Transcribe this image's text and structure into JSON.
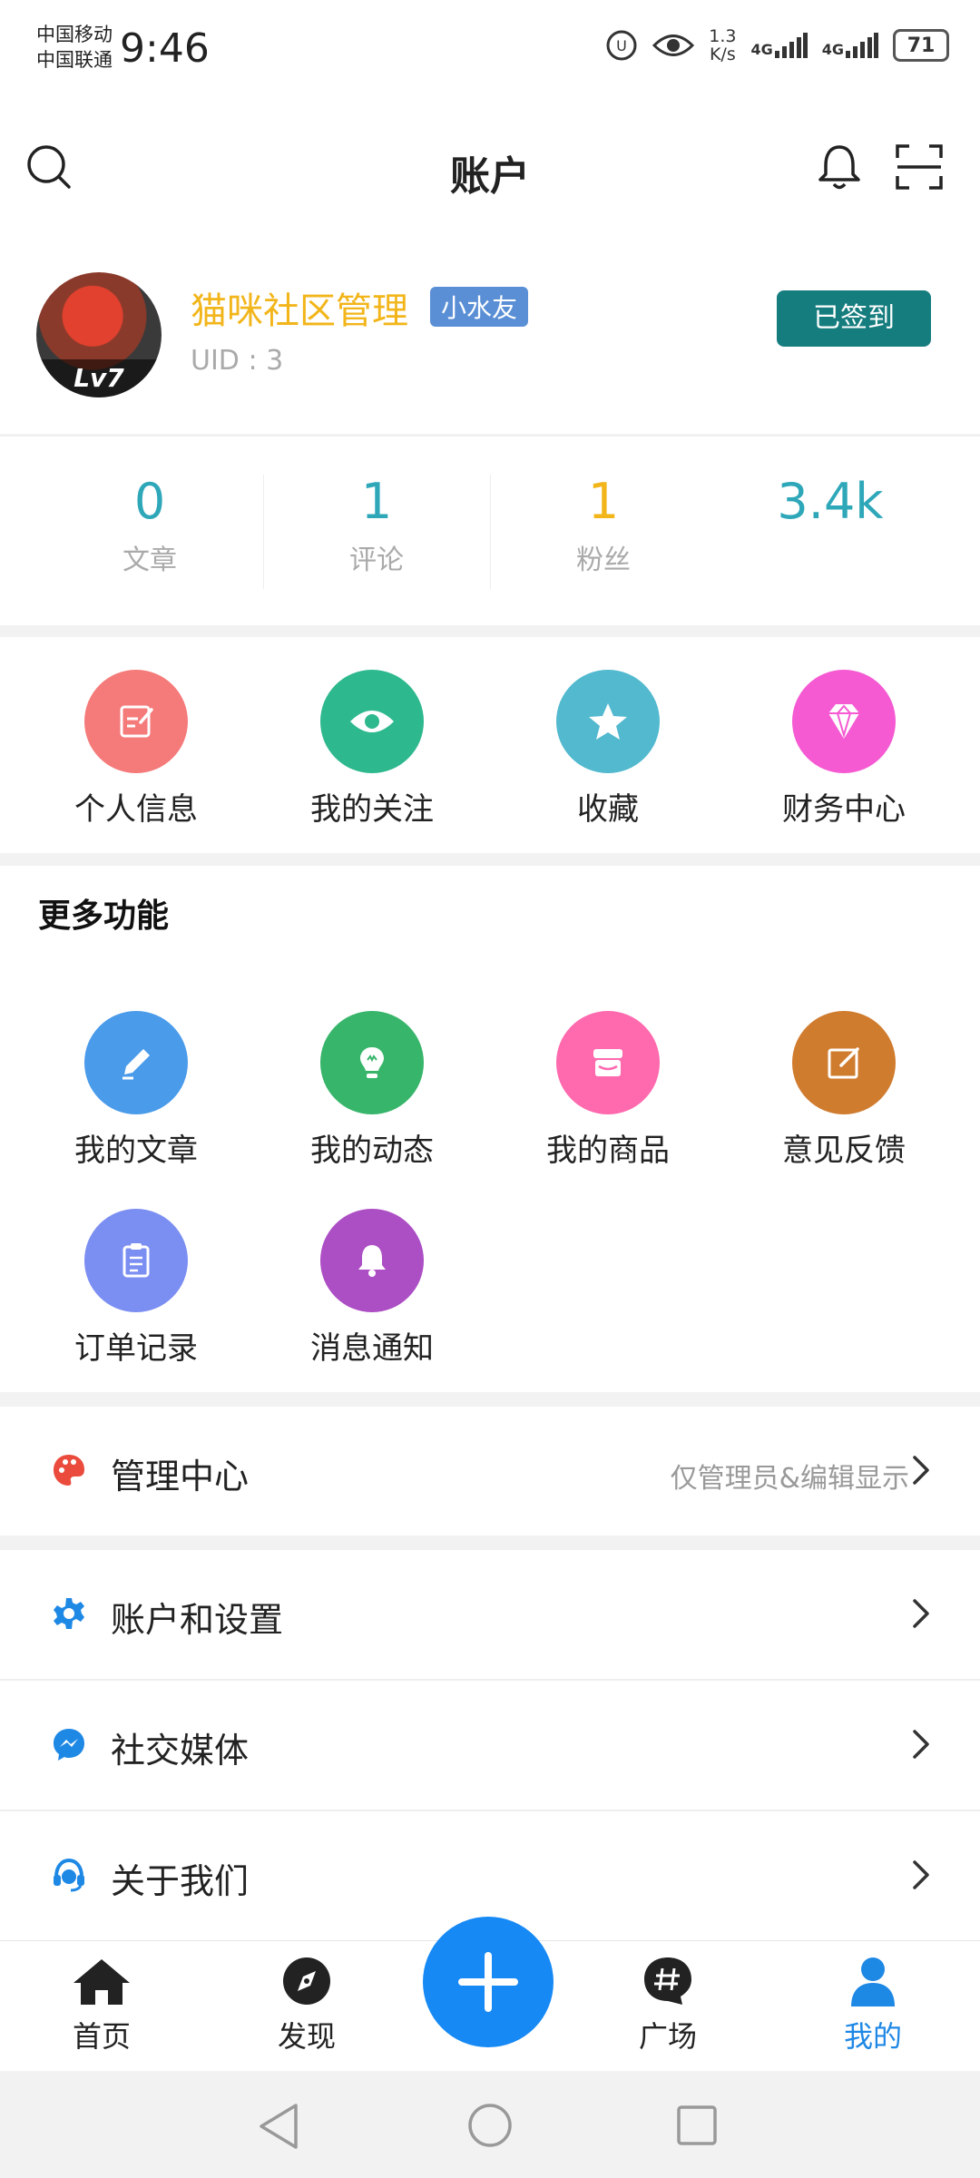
{
  "status_bar": {
    "carrier1": "中国移动",
    "carrier2": "中国联通",
    "time": "9:46",
    "speed_value": "1.3",
    "speed_unit": "K/s",
    "net1": "4G",
    "net2": "4G",
    "battery": "71"
  },
  "header": {
    "title": "账户"
  },
  "profile": {
    "name": "猫咪社区管理",
    "tag": "小水友",
    "uid": "UID : 3",
    "level": "Lv7",
    "checkin_label": "已签到"
  },
  "stats": [
    {
      "value": "0",
      "label": "文章",
      "color": "#2ea7b9"
    },
    {
      "value": "1",
      "label": "评论",
      "color": "#2ea7b9"
    },
    {
      "value": "1",
      "label": "粉丝",
      "color": "#f2b51a"
    },
    {
      "value": "3.4k",
      "label": "",
      "color": "#2ea7b9"
    }
  ],
  "quick_actions": [
    {
      "label": "个人信息",
      "icon": "edit-icon",
      "color": "#f57a7a"
    },
    {
      "label": "我的关注",
      "icon": "eye-icon",
      "color": "#2db88e"
    },
    {
      "label": "收藏",
      "icon": "star-icon",
      "color": "#52b9cf"
    },
    {
      "label": "财务中心",
      "icon": "diamond-icon",
      "color": "#f55ad2"
    }
  ],
  "more_features": {
    "title": "更多功能",
    "items": [
      {
        "label": "我的文章",
        "icon": "pencil-icon",
        "color": "#4a9bea"
      },
      {
        "label": "我的动态",
        "icon": "lightbulb-icon",
        "color": "#37b56a"
      },
      {
        "label": "我的商品",
        "icon": "store-icon",
        "color": "#ff69ae"
      },
      {
        "label": "意见反馈",
        "icon": "feedback-icon",
        "color": "#d07c2f"
      },
      {
        "label": "订单记录",
        "icon": "clipboard-icon",
        "color": "#7b8ef2"
      },
      {
        "label": "消息通知",
        "icon": "bell-icon",
        "color": "#ac4ec4"
      }
    ]
  },
  "menu": [
    {
      "label": "管理中心",
      "note": "仅管理员&编辑显示",
      "icon": "palette-icon",
      "color": "#ea4b3c"
    },
    {
      "label": "账户和设置",
      "note": "",
      "icon": "gear-icon",
      "color": "#1e88e5"
    },
    {
      "label": "社交媒体",
      "note": "",
      "icon": "messenger-icon",
      "color": "#1e88e5"
    },
    {
      "label": "关于我们",
      "note": "",
      "icon": "support-icon",
      "color": "#1e88e5"
    }
  ],
  "bottom_nav": [
    {
      "label": "首页",
      "icon": "home-icon"
    },
    {
      "label": "发现",
      "icon": "compass-icon"
    },
    {
      "label": "广场",
      "icon": "hashtag-icon"
    },
    {
      "label": "我的",
      "icon": "user-icon",
      "active_color": "#1e88e5"
    }
  ]
}
